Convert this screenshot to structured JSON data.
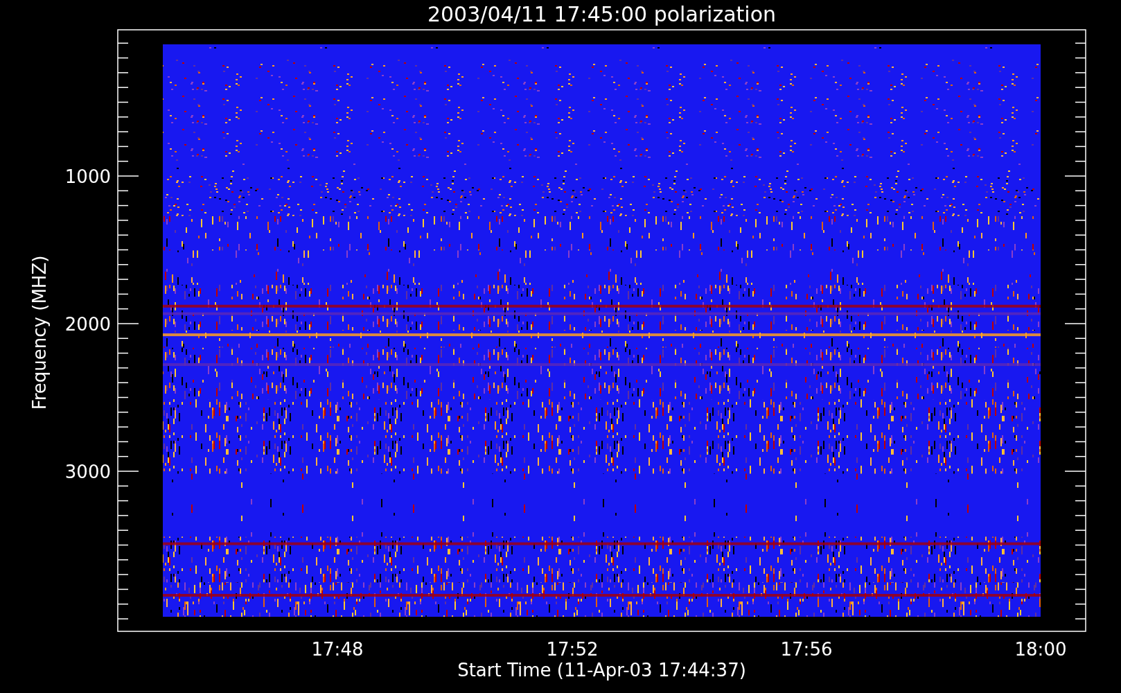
{
  "title": "2003/04/11 17:45:00 polarization",
  "y_axis": {
    "label": "Frequency (MHZ)",
    "ticks": [
      "1000",
      "2000",
      "3000"
    ]
  },
  "x_axis": {
    "label": "Start Time (11-Apr-03 17:44:37)",
    "ticks": [
      "17:48",
      "17:52",
      "17:56",
      "18:00"
    ]
  }
}
